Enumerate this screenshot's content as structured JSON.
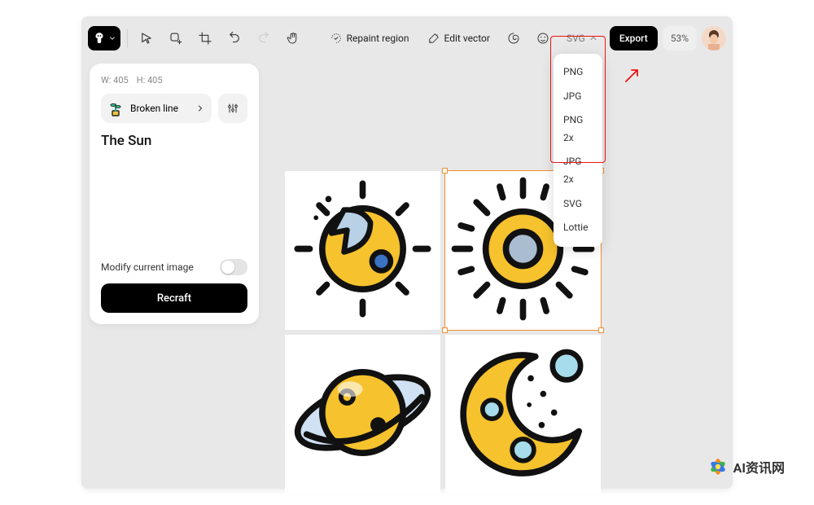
{
  "toolbar": {
    "repaint_label": "Repaint region",
    "edit_vector_label": "Edit vector",
    "format_label": "SVG",
    "export_label": "Export",
    "zoom_label": "53%"
  },
  "dropdown": {
    "items": [
      "PNG",
      "JPG",
      "PNG 2x",
      "JPG 2x",
      "SVG",
      "Lottie"
    ]
  },
  "panel": {
    "w_label": "W:",
    "w_value": "405",
    "h_label": "H:",
    "h_value": "405",
    "style_label": "Broken line",
    "prompt_text": "The Sun",
    "modify_label": "Modify current image",
    "recraft_label": "Recraft"
  },
  "watermark": {
    "text": "AI资讯网"
  }
}
